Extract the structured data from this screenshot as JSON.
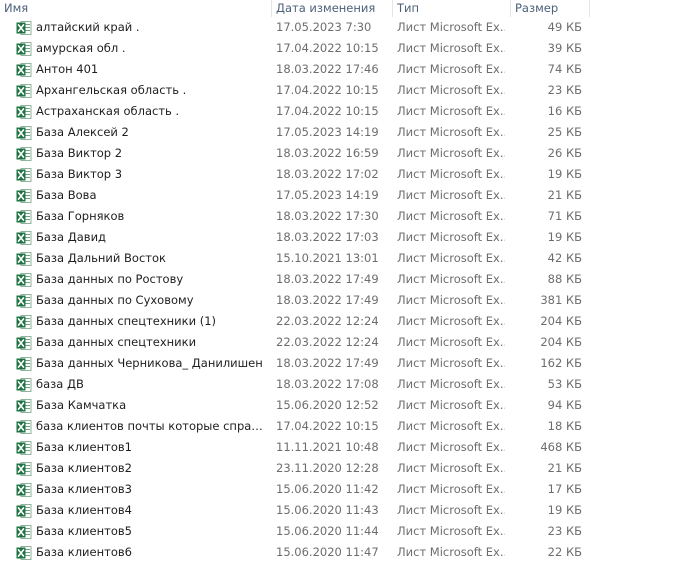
{
  "columns": {
    "name": "Имя",
    "date": "Дата изменения",
    "type": "Тип",
    "size": "Размер"
  },
  "icon": "excel-file-icon",
  "files": [
    {
      "name": "алтайский край .",
      "date": "17.05.2023 7:30",
      "type": "Лист Microsoft Ex...",
      "size": "49 КБ"
    },
    {
      "name": "амурская обл .",
      "date": "17.04.2022 10:15",
      "type": "Лист Microsoft Ex...",
      "size": "39 КБ"
    },
    {
      "name": "Антон 401",
      "date": "18.03.2022 17:46",
      "type": "Лист Microsoft Ex...",
      "size": "74 КБ"
    },
    {
      "name": "Архангельская область .",
      "date": "17.04.2022 10:15",
      "type": "Лист Microsoft Ex...",
      "size": "23 КБ"
    },
    {
      "name": "Астраханская область  .",
      "date": "17.04.2022 10:15",
      "type": "Лист Microsoft Ex...",
      "size": "16 КБ"
    },
    {
      "name": "База Алексей 2",
      "date": "17.05.2023 14:19",
      "type": "Лист Microsoft Ex...",
      "size": "25 КБ"
    },
    {
      "name": "База Виктор 2",
      "date": "18.03.2022 16:59",
      "type": "Лист Microsoft Ex...",
      "size": "26 КБ"
    },
    {
      "name": "База Виктор 3",
      "date": "18.03.2022 17:02",
      "type": "Лист Microsoft Ex...",
      "size": "19 КБ"
    },
    {
      "name": "База Вова",
      "date": "17.05.2023 14:19",
      "type": "Лист Microsoft Ex...",
      "size": "21 КБ"
    },
    {
      "name": "База Горняков",
      "date": "18.03.2022 17:30",
      "type": "Лист Microsoft Ex...",
      "size": "71 КБ"
    },
    {
      "name": "База Давид",
      "date": "18.03.2022 17:03",
      "type": "Лист Microsoft Ex...",
      "size": "19 КБ"
    },
    {
      "name": "База Дальний Восток",
      "date": "15.10.2021 13:01",
      "type": "Лист Microsoft Ex...",
      "size": "42 КБ"
    },
    {
      "name": "База данных по Ростову",
      "date": "18.03.2022 17:49",
      "type": "Лист Microsoft Ex...",
      "size": "88 КБ"
    },
    {
      "name": "База данных по Суховому",
      "date": "18.03.2022 17:49",
      "type": "Лист Microsoft Ex...",
      "size": "381 КБ"
    },
    {
      "name": "База данных спецтехники (1)",
      "date": "22.03.2022 12:24",
      "type": "Лист Microsoft Ex...",
      "size": "204 КБ"
    },
    {
      "name": "База данных спецтехники",
      "date": "22.03.2022 12:24",
      "type": "Лист Microsoft Ex...",
      "size": "204 КБ"
    },
    {
      "name": "База данных Черникова_ Данилишен",
      "date": "18.03.2022 17:49",
      "type": "Лист Microsoft Ex...",
      "size": "162 КБ"
    },
    {
      "name": "база ДВ",
      "date": "18.03.2022 17:08",
      "type": "Лист Microsoft Ex...",
      "size": "53 КБ"
    },
    {
      "name": "База Камчатка",
      "date": "15.06.2020 12:52",
      "type": "Лист Microsoft Ex...",
      "size": "94 КБ"
    },
    {
      "name": "база клиентов почты которые спраши...",
      "date": "17.04.2022 10:15",
      "type": "Лист Microsoft Ex...",
      "size": "18 КБ"
    },
    {
      "name": "База клиентов1",
      "date": "11.11.2021 10:48",
      "type": "Лист Microsoft Ex...",
      "size": "468 КБ"
    },
    {
      "name": "База клиентов2",
      "date": "23.11.2020 12:28",
      "type": "Лист Microsoft Ex...",
      "size": "21 КБ"
    },
    {
      "name": "База клиентов3",
      "date": "15.06.2020 11:42",
      "type": "Лист Microsoft Ex...",
      "size": "17 КБ"
    },
    {
      "name": "База клиентов4",
      "date": "15.06.2020 11:43",
      "type": "Лист Microsoft Ex...",
      "size": "19 КБ"
    },
    {
      "name": "База клиентов5",
      "date": "15.06.2020 11:44",
      "type": "Лист Microsoft Ex...",
      "size": "23 КБ"
    },
    {
      "name": "База клиентов6",
      "date": "15.06.2020 11:47",
      "type": "Лист Microsoft Ex...",
      "size": "22 КБ"
    }
  ]
}
